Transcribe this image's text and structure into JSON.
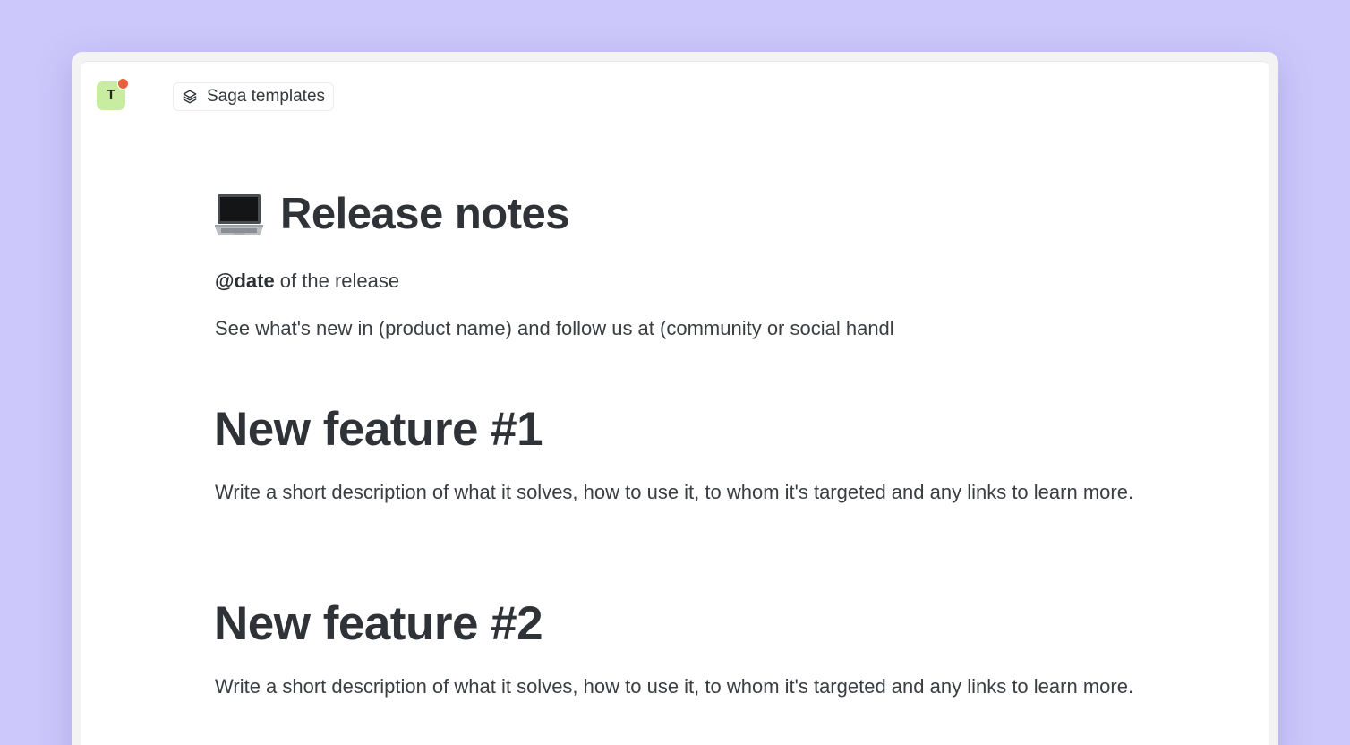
{
  "workspace": {
    "avatar_letter": "T",
    "notification_color": "#e8603c",
    "avatar_color": "#c8eda0"
  },
  "breadcrumb": {
    "icon": "layers-icon",
    "label": "Saga templates"
  },
  "page": {
    "icon": "laptop-emoji",
    "title": "Release notes",
    "date_mention": "@date",
    "date_suffix": " of the release",
    "intro": "See what's new in (product name) and follow us at (community or social handl"
  },
  "features": [
    {
      "heading": "New feature #1",
      "description": "Write a short description of what it solves, how to use it, to whom it's targeted and any links to learn more."
    },
    {
      "heading": "New feature #2",
      "description": "Write a short description of what it solves, how to use it, to whom it's targeted and any links to learn more."
    }
  ],
  "colors": {
    "background": "#cdc8fb",
    "text": "#2f3337"
  }
}
